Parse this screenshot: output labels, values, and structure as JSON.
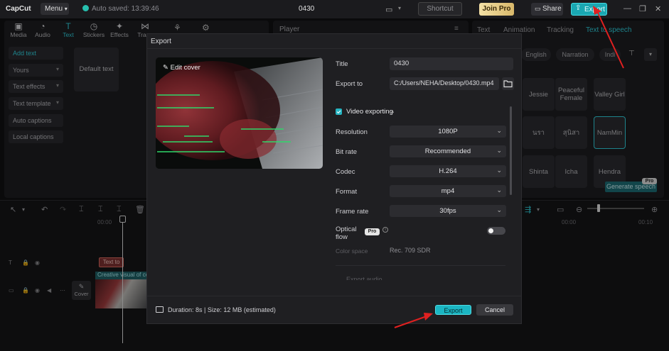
{
  "app": {
    "name": "CapCut",
    "menu_label": "Menu",
    "autosave": "Auto saved: 13:39:46",
    "project_title": "0430"
  },
  "topbar": {
    "shortcut_label": "Shortcut",
    "join_pro_label": "Join Pro",
    "share_label": "Share",
    "export_label": "Export"
  },
  "toolbar": {
    "tools": [
      {
        "label": "Media",
        "icon": "media-icon"
      },
      {
        "label": "Audio",
        "icon": "audio-icon"
      },
      {
        "label": "Text",
        "icon": "text-icon"
      },
      {
        "label": "Stickers",
        "icon": "stickers-icon"
      },
      {
        "label": "Effects",
        "icon": "effects-icon"
      },
      {
        "label": "Trans",
        "icon": "transitions-icon"
      }
    ]
  },
  "left_nav": {
    "items": [
      "Add text",
      "Yours",
      "Text effects",
      "Text template",
      "Auto captions",
      "Local captions"
    ],
    "default_text_card": "Default text"
  },
  "player": {
    "label": "Player"
  },
  "right_panel": {
    "tabs": [
      "Text",
      "Animation",
      "Tracking",
      "Text to speech"
    ],
    "filters": [
      "English",
      "Narration",
      "Indi"
    ],
    "voices": [
      "Jessie",
      "Peaceful Female",
      "Valley Girl",
      "นรา",
      "สุนิสา",
      "NamMin",
      "Shinta",
      "Icha",
      "Hendra"
    ],
    "generate_label": "Generate speech",
    "pro_badge": "Pro"
  },
  "timeline": {
    "timecodes": [
      "00:00",
      "00:00",
      "00:10"
    ],
    "text_clip": "Text to",
    "video_clip": "Creative visual of co",
    "cover_label": "Cover"
  },
  "dialog": {
    "title": "Export",
    "edit_cover": "Edit cover",
    "fields": {
      "title_label": "Title",
      "title_value": "0430",
      "export_to_label": "Export to",
      "export_to_value": "C:/Users/NEHA/Desktop/0430.mp4"
    },
    "video_section": "Video exporting",
    "settings": [
      {
        "label": "Resolution",
        "value": "1080P"
      },
      {
        "label": "Bit rate",
        "value": "Recommended"
      },
      {
        "label": "Codec",
        "value": "H.264"
      },
      {
        "label": "Format",
        "value": "mp4"
      },
      {
        "label": "Frame rate",
        "value": "30fps"
      }
    ],
    "optical_flow_label": "Optical flow",
    "optical_flow_pro": "Pro",
    "optical_flow_on": false,
    "color_space_label": "Color space",
    "color_space_value": "Rec. 709 SDR",
    "export_audio_label": "Export audio",
    "footer_info": "Duration: 8s | Size: 12 MB (estimated)",
    "export_button": "Export",
    "cancel_button": "Cancel"
  },
  "colors": {
    "accent": "#1bb6c3",
    "annotation_arrow": "#e02020"
  }
}
